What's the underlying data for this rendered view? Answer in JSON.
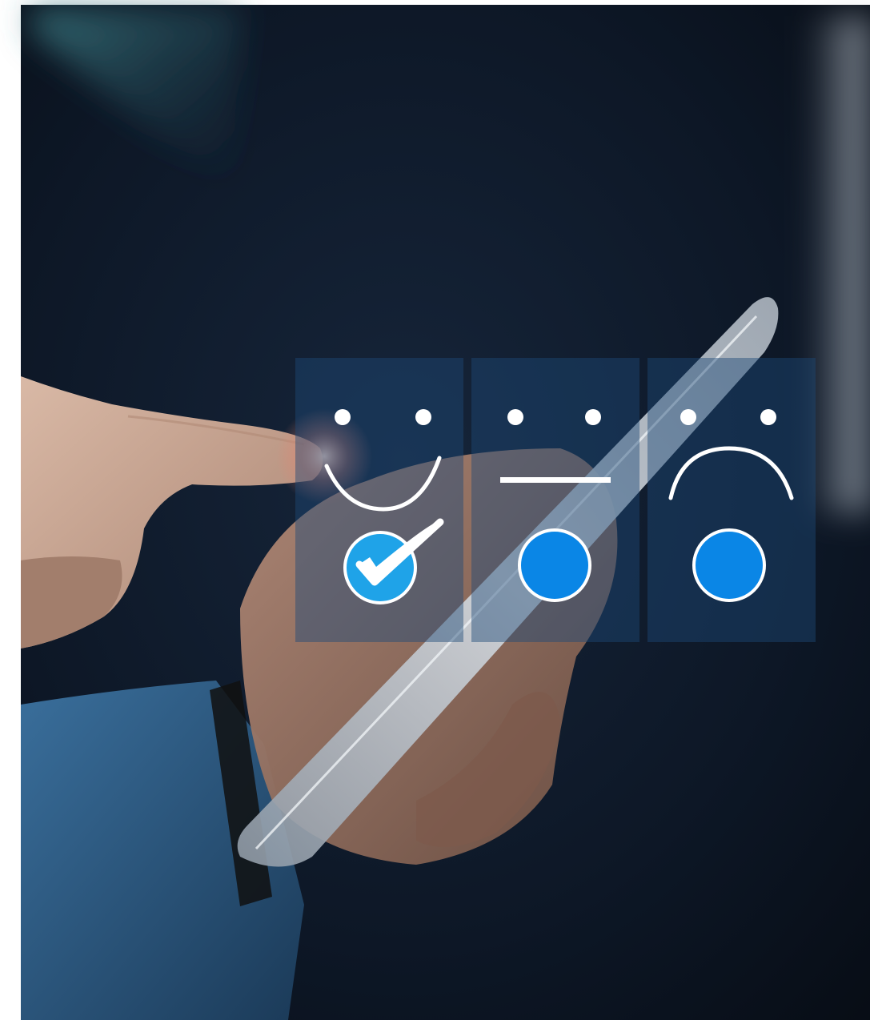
{
  "scene": {
    "background_color": "#0d1624",
    "frame_color": "#ffffff",
    "accent_color": "#0a86e6",
    "check_color": "#1fa3e8",
    "panel_color": "#1d4a78",
    "icons": [
      "happy-face-icon",
      "neutral-face-icon",
      "sad-face-icon",
      "checkmark-icon"
    ]
  },
  "rating": {
    "options": [
      {
        "face": "happy",
        "selected": true
      },
      {
        "face": "neutral",
        "selected": false
      },
      {
        "face": "sad",
        "selected": false
      }
    ]
  }
}
